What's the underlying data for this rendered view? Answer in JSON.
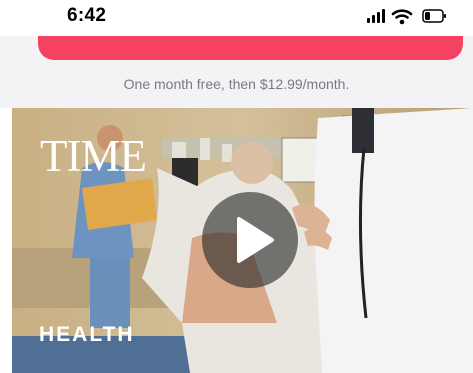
{
  "status_bar": {
    "time": "6:42",
    "icons": [
      "signal-icon",
      "wifi-icon",
      "battery-icon"
    ]
  },
  "subscribe": {
    "button_color": "#f44361",
    "price_note": "One month free, then $12.99/month."
  },
  "video": {
    "logo": "TIME",
    "category": "HEALTH",
    "play_icon": "play-icon"
  }
}
